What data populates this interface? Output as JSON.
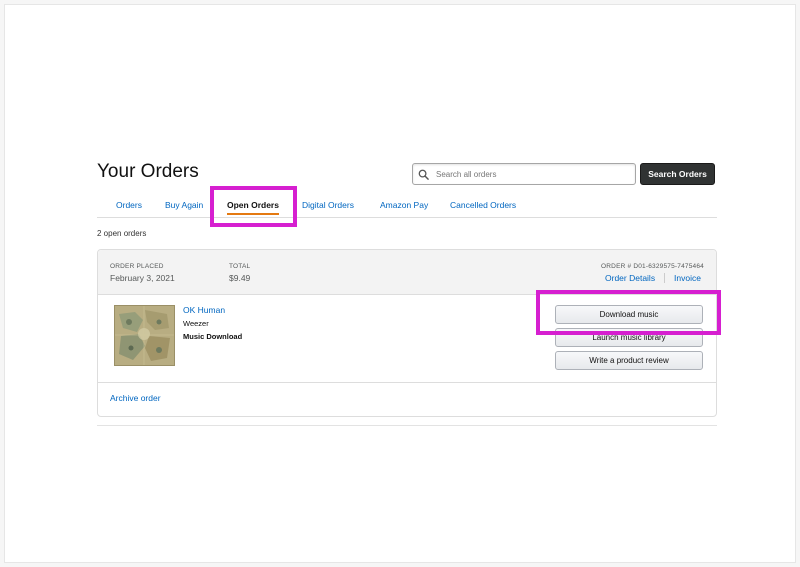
{
  "header": {
    "title": "Your Orders",
    "search_placeholder": "Search all orders",
    "search_button": "Search Orders"
  },
  "tabs": [
    {
      "label": "Orders",
      "active": false
    },
    {
      "label": "Buy Again",
      "active": false
    },
    {
      "label": "Open Orders",
      "active": true
    },
    {
      "label": "Digital Orders",
      "active": false
    },
    {
      "label": "Amazon Pay",
      "active": false
    },
    {
      "label": "Cancelled Orders",
      "active": false
    }
  ],
  "open_count": "2 open orders",
  "order": {
    "placed_label": "ORDER PLACED",
    "placed_value": "February 3, 2021",
    "total_label": "TOTAL",
    "total_value": "$9.49",
    "order_number": "ORDER # D01-6329575-7475464",
    "details_link": "Order Details",
    "invoice_link": "Invoice",
    "item": {
      "title": "OK Human",
      "artist": "Weezer",
      "type": "Music Download"
    },
    "actions": [
      "Download music",
      "Launch music library",
      "Write a product review"
    ],
    "archive_link": "Archive order"
  },
  "colors": {
    "link": "#0066c0",
    "highlight": "#d61fd0",
    "tab_underline": "#e47911",
    "search_button_bg": "#303333"
  }
}
